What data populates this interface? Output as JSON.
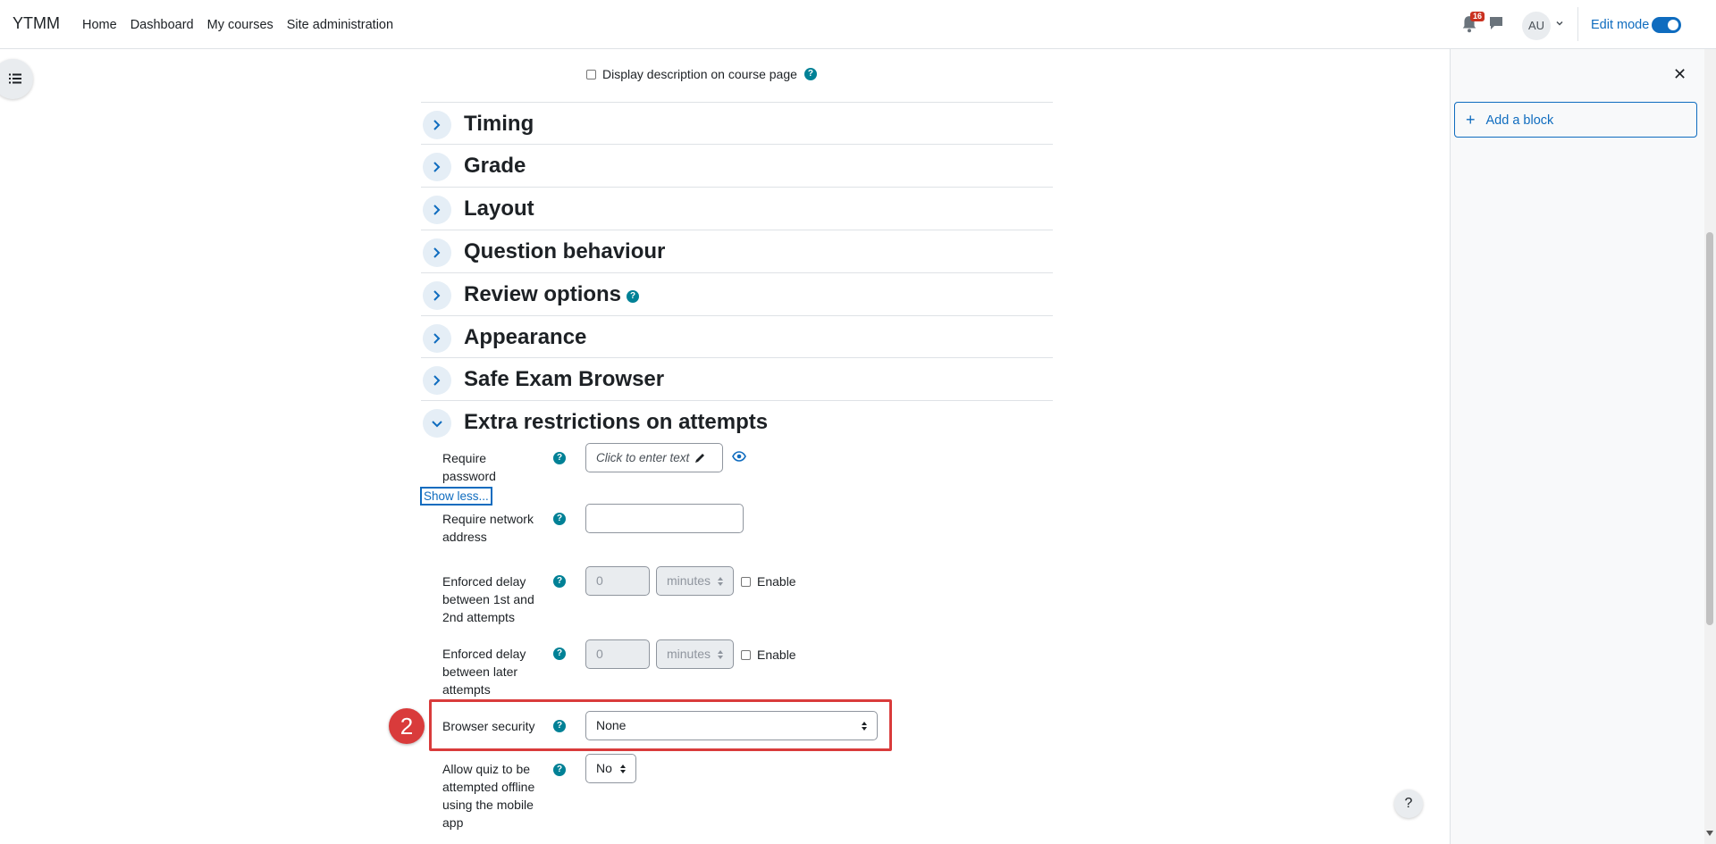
{
  "navbar": {
    "brand": "YTMM",
    "links": [
      "Home",
      "Dashboard",
      "My courses",
      "Site administration"
    ],
    "notification_count": "16",
    "avatar_initials": "AU",
    "edit_mode_label": "Edit mode",
    "edit_mode_on": true
  },
  "block_drawer": {
    "add_block_label": "Add a block"
  },
  "form": {
    "display_description_label": "Display description on course page",
    "sections": [
      {
        "title": "Timing",
        "expanded": false
      },
      {
        "title": "Grade",
        "expanded": false
      },
      {
        "title": "Layout",
        "expanded": false
      },
      {
        "title": "Question behaviour",
        "expanded": false
      },
      {
        "title": "Review options",
        "expanded": false
      },
      {
        "title": "Appearance",
        "expanded": false
      },
      {
        "title": "Safe Exam Browser",
        "expanded": false
      },
      {
        "title": "Extra restrictions on attempts",
        "expanded": true
      }
    ],
    "require_password": {
      "label": "Require password",
      "placeholder": "Click to enter text"
    },
    "show_less_label": "Show less...",
    "require_network": {
      "label": "Require network address",
      "value": ""
    },
    "delay_1_2": {
      "label": "Enforced delay between 1st and 2nd attempts",
      "value": "0",
      "unit": "minutes",
      "enable_label": "Enable"
    },
    "delay_later": {
      "label": "Enforced delay between later attempts",
      "value": "0",
      "unit": "minutes",
      "enable_label": "Enable"
    },
    "browser_security": {
      "label": "Browser security",
      "value": "None",
      "step_number": "2"
    },
    "offline": {
      "label": "Allow quiz to be attempted offline using the mobile app",
      "value": "No"
    }
  },
  "help_button_label": "?",
  "colors": {
    "accent": "#0f6cbf",
    "help_icon": "#008196",
    "highlight": "#d93b3b"
  }
}
